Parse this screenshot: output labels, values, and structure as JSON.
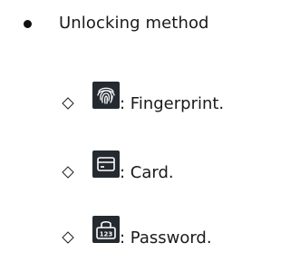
{
  "section": {
    "title": "Unlocking method"
  },
  "methods": [
    {
      "icon": "fingerprint-icon",
      "label": ": Fingerprint."
    },
    {
      "icon": "card-icon",
      "label": ": Card."
    },
    {
      "icon": "password-keypad-icon",
      "label": ": Password.",
      "icon_text": "123"
    }
  ],
  "colors": {
    "icon_background": "#242a30",
    "icon_foreground": "#ffffff",
    "text": "#1a1a1a"
  }
}
